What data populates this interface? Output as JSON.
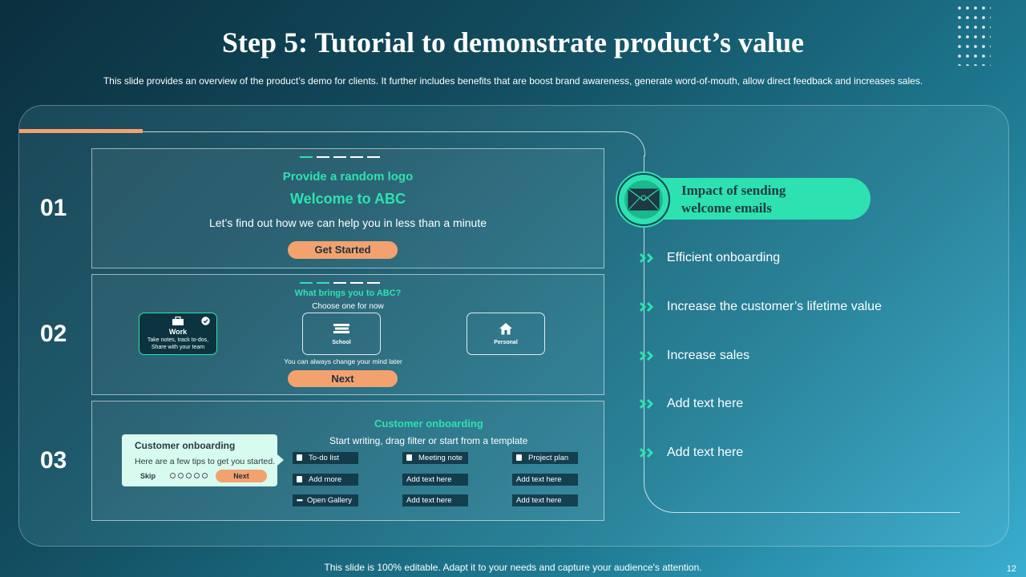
{
  "slide": {
    "title": "Step 5: Tutorial to demonstrate product’s value",
    "subtitle": "This slide provides an overview of the product’s demo for clients. It further includes benefits that are boost brand awareness, generate word-of-mouth, allow direct feedback and increases sales.",
    "footer": "This slide is 100% editable. Adapt it to your needs and capture your audience's attention.",
    "page_number": "12"
  },
  "steps": [
    {
      "number": "01",
      "logo_text": "Provide a random logo",
      "welcome": "Welcome to ABC",
      "tagline": "Let’s find out how we can help you in less than a minute",
      "button": "Get Started"
    },
    {
      "number": "02",
      "question": "What brings you to ABC?",
      "instruction": "Choose one for now",
      "options": [
        {
          "title": "Work",
          "desc": "Take notes, track to-dos, Share with your team",
          "icon": "briefcase-icon",
          "selected": true
        },
        {
          "title": "School",
          "icon": "books-icon",
          "selected": false
        },
        {
          "title": "Personal",
          "icon": "house-icon",
          "selected": false
        }
      ],
      "note": "You can always change your mind later",
      "button": "Next"
    },
    {
      "number": "03",
      "heading": "Customer onboarding",
      "instruction": "Start writing, drag filter or start from a template",
      "tip": {
        "title": "Customer onboarding",
        "text": "Here are a few tips to get you started.",
        "skip": "Skip",
        "next": "Next",
        "progress_dots": 5
      },
      "templates": [
        [
          "To-do list",
          "Meeting note",
          "Project plan"
        ],
        [
          "Add more",
          "Add text here",
          "Add text here"
        ],
        [
          "Open Gallery",
          "Add text here",
          "Add text here"
        ]
      ]
    }
  ],
  "impact": {
    "title_line1": "Impact of sending",
    "title_line2": "welcome emails",
    "icon": "envelope-icon",
    "items": [
      "Efficient onboarding",
      "Increase the customer’s lifetime value",
      "Increase sales",
      "Add text here",
      "Add text here"
    ]
  },
  "colors": {
    "accent_green": "#2de2b0",
    "accent_orange": "#f3a26f",
    "background_dark": "#0b2f3f",
    "background_light": "#3aaed0"
  }
}
